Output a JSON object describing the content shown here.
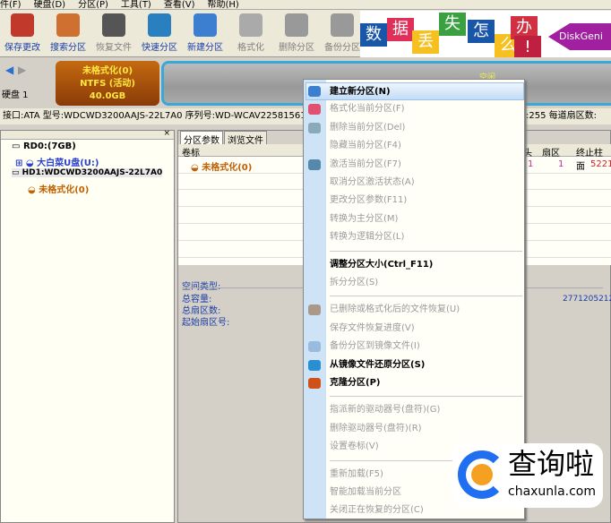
{
  "menubar": [
    "件(F)",
    "硬盘(D)",
    "分区(P)",
    "工具(T)",
    "查看(V)",
    "帮助(H)"
  ],
  "toolbar": [
    {
      "label": "保存更改",
      "icon": "save-icon",
      "enabled": true,
      "color": "#c0392b"
    },
    {
      "label": "搜索分区",
      "icon": "search-icon",
      "enabled": true,
      "color": "#d07030"
    },
    {
      "label": "恢复文件",
      "icon": "recover-icon",
      "enabled": false,
      "color": "#555"
    },
    {
      "label": "快速分区",
      "icon": "quick-partition-icon",
      "enabled": true,
      "color": "#2a7fc0"
    },
    {
      "label": "新建分区",
      "icon": "new-partition-icon",
      "enabled": true,
      "color": "#3c7fd0"
    },
    {
      "label": "格式化",
      "icon": "format-icon",
      "enabled": false,
      "color": "#aaa"
    },
    {
      "label": "删除分区",
      "icon": "delete-icon",
      "enabled": false,
      "color": "#999"
    },
    {
      "label": "备份分区",
      "icon": "backup-icon",
      "enabled": false,
      "color": "#999"
    }
  ],
  "banner": {
    "chars": [
      "数",
      "据",
      "丢",
      "失",
      "怎",
      "么",
      "办",
      "!"
    ],
    "brand": "DiskGeni"
  },
  "disk": {
    "label": "硬盘 1",
    "partition_name": "未格式化(0)",
    "partition_fs": "NTFS (活动)",
    "partition_size": "40.0GB",
    "free_label": "空闲"
  },
  "info": {
    "text": "接口:ATA  型号:WDCWD3200AAJS-22L7A0  序列号:WD-WCAV22581561",
    "right": ":255   每道扇区数:"
  },
  "tree": {
    "rd0": "RD0:(7GB)",
    "rd0_child": "大白菜U盘(U:)",
    "hd1": "HD1:WDCWD3200AAJS-22L7A0",
    "hd1_child": "未格式化(0)",
    "close": "×"
  },
  "tabs": [
    "分区参数",
    "浏览文件"
  ],
  "table": {
    "col_label": "卷标",
    "cols": [
      "头",
      "扇区",
      "终止柱面"
    ],
    "row": {
      "label": "未格式化(0)",
      "head": "1",
      "sector": "1",
      "end_cyl": "5221"
    }
  },
  "details": {
    "space_type": "空间类型:",
    "total_capacity": "总容量:",
    "total_sectors": "总扇区数:",
    "start_sector": "起始扇区号:",
    "value": "2771205212"
  },
  "context_menu": [
    {
      "label": "建立新分区(N)",
      "state": "hi",
      "icon": "new-partition-icon",
      "color": "#3c7fd0"
    },
    {
      "label": "格式化当前分区(F)",
      "state": "dis",
      "icon": "format-icon",
      "color": "#e05070"
    },
    {
      "label": "删除当前分区(Del)",
      "state": "dis",
      "icon": "delete-icon",
      "color": "#8ab"
    },
    {
      "label": "隐藏当前分区(F4)",
      "state": "dis"
    },
    {
      "label": "激活当前分区(F7)",
      "state": "dis",
      "icon": "activate-icon",
      "color": "#58a"
    },
    {
      "label": "取消分区激活状态(A)",
      "state": "dis"
    },
    {
      "label": "更改分区参数(F11)",
      "state": "dis"
    },
    {
      "label": "转换为主分区(M)",
      "state": "dis"
    },
    {
      "label": "转换为逻辑分区(L)",
      "state": "dis",
      "sep": true
    },
    {
      "label": "调整分区大小(Ctrl_F11)",
      "state": "en"
    },
    {
      "label": "拆分分区(S)",
      "state": "dis",
      "sep": true
    },
    {
      "label": "已删除或格式化后的文件恢复(U)",
      "state": "dis",
      "icon": "recover-icon",
      "color": "#a98"
    },
    {
      "label": "保存文件恢复进度(V)",
      "state": "dis"
    },
    {
      "label": "备份分区到镜像文件(I)",
      "state": "dis",
      "icon": "backup-icon",
      "color": "#9bd"
    },
    {
      "label": "从镜像文件还原分区(S)",
      "state": "en",
      "icon": "restore-icon",
      "color": "#2a8fd0"
    },
    {
      "label": "克隆分区(P)",
      "state": "en",
      "icon": "clone-icon",
      "color": "#d0501a",
      "sep": true
    },
    {
      "label": "指派新的驱动器号(盘符)(G)",
      "state": "dis"
    },
    {
      "label": "删除驱动器号(盘符)(R)",
      "state": "dis"
    },
    {
      "label": "设置卷标(V)",
      "state": "dis",
      "sep": true
    },
    {
      "label": "重新加载(F5)",
      "state": "dis"
    },
    {
      "label": "智能加载当前分区",
      "state": "dis"
    },
    {
      "label": "关闭正在恢复的分区(C)",
      "state": "dis"
    }
  ],
  "watermark": {
    "title": "查询啦",
    "url": "chaxunla.com"
  }
}
